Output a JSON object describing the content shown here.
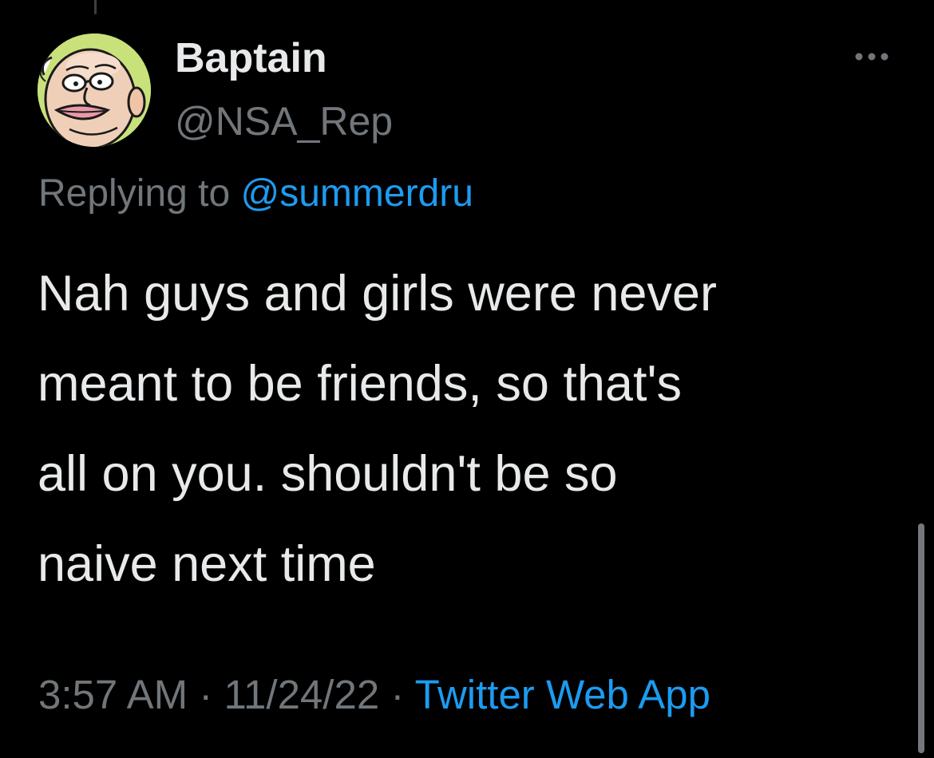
{
  "tweet": {
    "author": {
      "display_name": "Baptain",
      "handle": "@NSA_Rep",
      "avatar_icon": "cartoon-face-avatar"
    },
    "more_icon": "ellipsis-icon",
    "replying_to": {
      "prefix": "Replying to",
      "mention": "@summerdru"
    },
    "text_lines": [
      "Nah guys and girls were never",
      "meant to be friends, so that's",
      "all on you. shouldn't be so",
      "naive next time"
    ],
    "time": "3:57 AM",
    "separator": "·",
    "date": "11/24/22",
    "source": "Twitter Web App"
  },
  "colors": {
    "background": "#000000",
    "text_primary": "#e7e9ea",
    "text_secondary": "#71767b",
    "link": "#1d9bf0",
    "avatar_bg": "#c9e17a"
  }
}
